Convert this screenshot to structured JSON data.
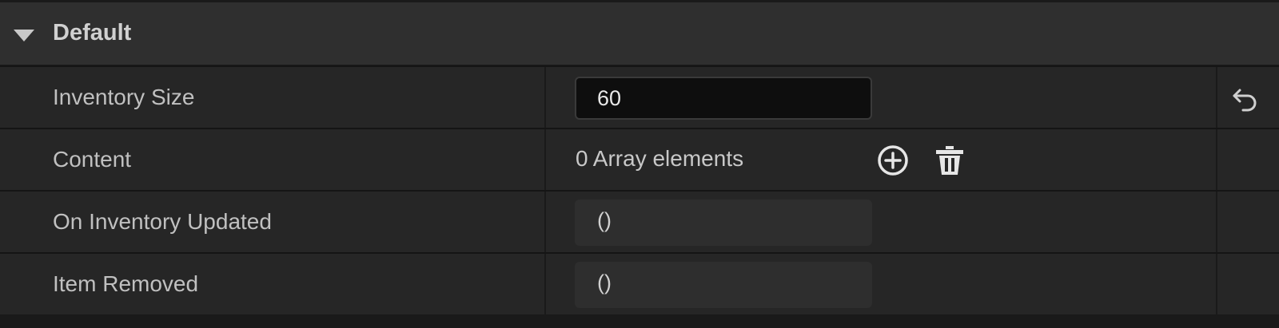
{
  "category": {
    "title": "Default",
    "expanded": true,
    "arrow_icon": "triangle-down-icon"
  },
  "rows": [
    {
      "name": "Inventory Size",
      "value": "60",
      "reset_icon": "reset-to-default-icon"
    },
    {
      "name": "Content",
      "array_label": "0 Array elements",
      "add_icon": "plus-circle-icon",
      "delete_icon": "trash-icon"
    },
    {
      "name": "On Inventory Updated",
      "value": "()"
    },
    {
      "name": "Item Removed",
      "value": "()"
    }
  ],
  "colors": {
    "background": "#1a1a1a",
    "header": "#2f2f2f",
    "row": "#262626",
    "input_dark": "#0e0e0e",
    "delegate_field": "#2e2e2e",
    "text": "#c0c0c0"
  }
}
